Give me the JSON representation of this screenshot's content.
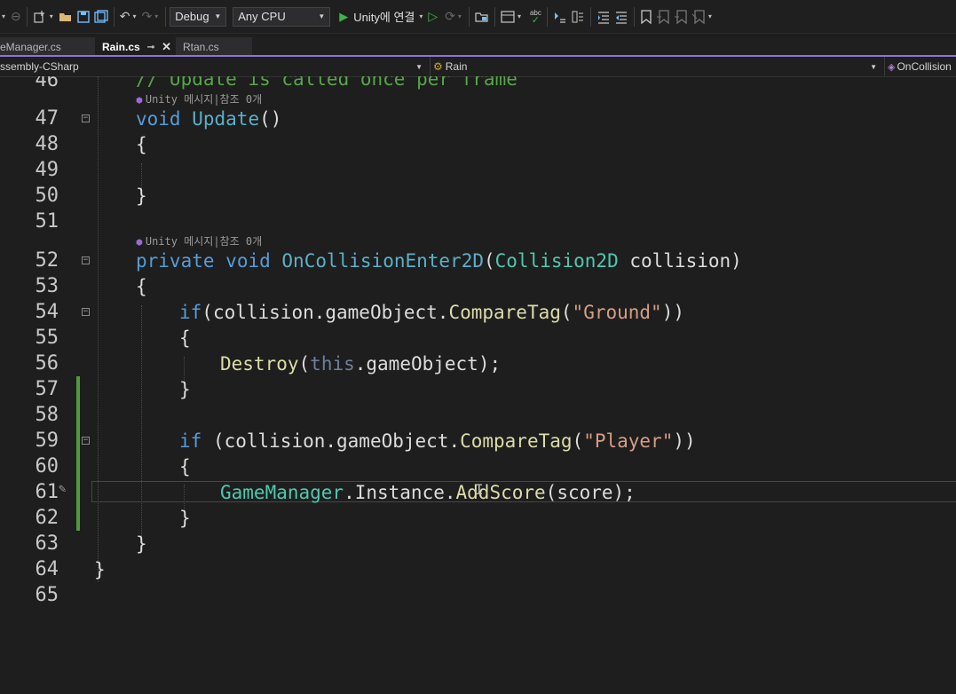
{
  "toolbar": {
    "config": "Debug",
    "platform": "Any CPU",
    "run_label": "Unity에 연결",
    "icons": [
      "back-icon",
      "forward-icon",
      "new-item-icon",
      "open-folder-icon",
      "save-icon",
      "save-all-icon",
      "undo-icon",
      "redo-icon",
      "play-icon",
      "play-outline-icon",
      "attach-icon",
      "folder-icon",
      "layout-icon",
      "spellcheck-icon",
      "comment-icon",
      "uncomment-icon",
      "indent-icon",
      "outdent-icon",
      "bookmark-icon",
      "prev-bookmark-icon",
      "next-bookmark-icon",
      "clear-bookmark-icon"
    ]
  },
  "tabs": [
    {
      "label": "eManager.cs",
      "active": false
    },
    {
      "label": "Rain.cs",
      "active": true
    },
    {
      "label": "Rtan.cs",
      "active": false
    }
  ],
  "navbar": {
    "project": "ssembly-CSharp",
    "type": "Rain",
    "member": "OnCollision"
  },
  "codelens": {
    "text": "Unity 메시지|참조 0개"
  },
  "lines": [
    {
      "n": "46",
      "text": "// Update is called once per frame"
    },
    {
      "n": "47",
      "text": "void Update()"
    },
    {
      "n": "48",
      "text": "{"
    },
    {
      "n": "49",
      "text": ""
    },
    {
      "n": "50",
      "text": "}"
    },
    {
      "n": "51",
      "text": ""
    },
    {
      "n": "52",
      "text": "private void OnCollisionEnter2D(Collision2D collision)"
    },
    {
      "n": "53",
      "text": "{"
    },
    {
      "n": "54",
      "text": "if(collision.gameObject.CompareTag(\"Ground\"))"
    },
    {
      "n": "55",
      "text": "{"
    },
    {
      "n": "56",
      "text": "Destroy(this.gameObject);"
    },
    {
      "n": "57",
      "text": "}"
    },
    {
      "n": "58",
      "text": ""
    },
    {
      "n": "59",
      "text": "if (collision.gameObject.CompareTag(\"Player\"))"
    },
    {
      "n": "60",
      "text": "{"
    },
    {
      "n": "61",
      "text": "GameManager.Instance.AddScore(score);"
    },
    {
      "n": "62",
      "text": "}"
    },
    {
      "n": "63",
      "text": "}"
    },
    {
      "n": "64",
      "text": "}"
    },
    {
      "n": "65",
      "text": ""
    }
  ]
}
